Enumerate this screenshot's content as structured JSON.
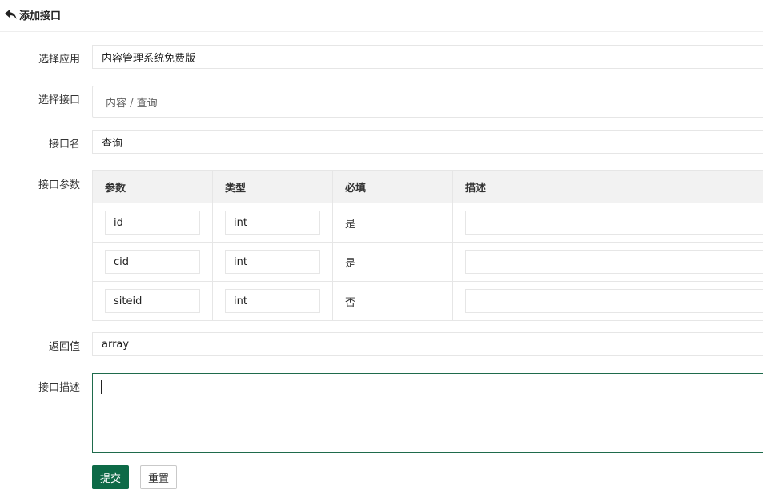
{
  "header": {
    "back_icon": "reply-arrow-icon",
    "title": "添加接口"
  },
  "form": {
    "app": {
      "label": "选择应用",
      "value": "内容管理系统免费版"
    },
    "api_select": {
      "label": "选择接口",
      "value": "内容 / 查询"
    },
    "api_name": {
      "label": "接口名",
      "value": "查询"
    },
    "params": {
      "label": "接口参数",
      "columns": [
        "参数",
        "类型",
        "必填",
        "描述"
      ],
      "rows": [
        {
          "name": "id",
          "type": "int",
          "required": "是",
          "desc": ""
        },
        {
          "name": "cid",
          "type": "int",
          "required": "是",
          "desc": ""
        },
        {
          "name": "siteid",
          "type": "int",
          "required": "否",
          "desc": ""
        }
      ]
    },
    "return_value": {
      "label": "返回值",
      "value": "array"
    },
    "description": {
      "label": "接口描述",
      "value": ""
    }
  },
  "buttons": {
    "submit": "提交",
    "reset": "重置"
  },
  "colors": {
    "primary": "#0d6a47",
    "focus_border": "#1f6b4c",
    "table_header_bg": "#f2f2f2",
    "border": "#e6e6e6"
  }
}
